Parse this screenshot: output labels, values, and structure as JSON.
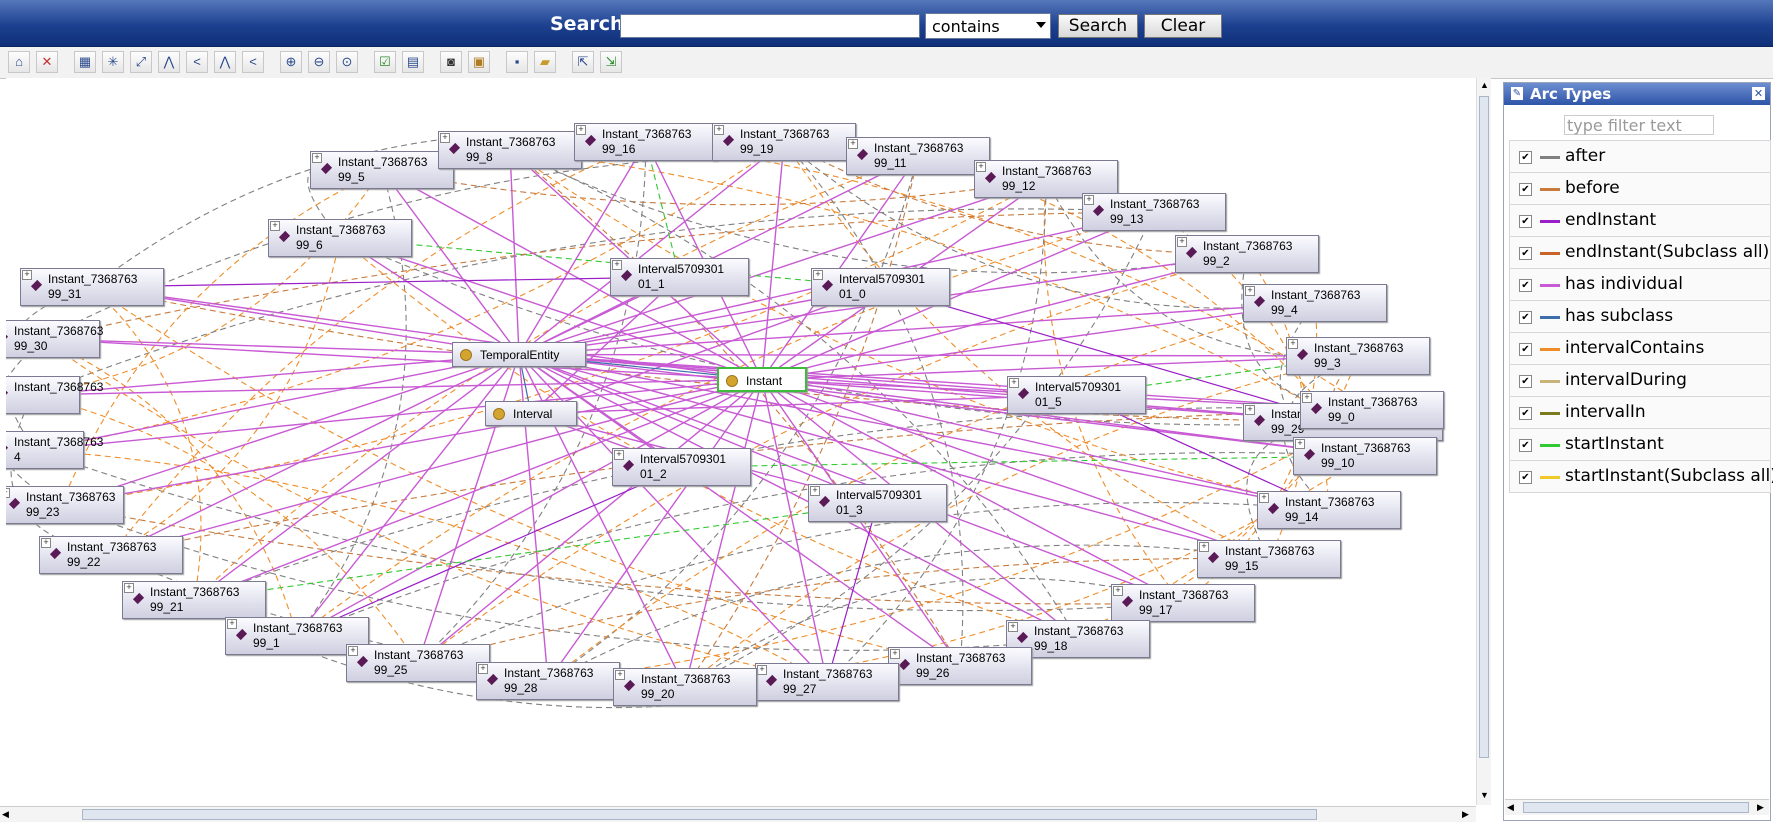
{
  "search": {
    "label": "Search:",
    "value": "",
    "mode": "contains",
    "search_button": "Search",
    "clear_button": "Clear"
  },
  "toolbar": {
    "icons": [
      "home-icon",
      "reset-icon",
      "grid-layout-icon",
      "radial-layout-icon",
      "spring-layout-icon",
      "tree-down-icon",
      "tree-left-icon",
      "tree-down-alt-icon",
      "tree-left-alt-icon",
      "zoom-in-icon",
      "zoom-out-icon",
      "zoom-fit-icon",
      "filter-icon",
      "options-icon",
      "snapshot-icon",
      "export-image-icon",
      "save-icon",
      "open-icon",
      "export-icon",
      "import-icon"
    ]
  },
  "graph": {
    "classes": [
      {
        "id": "temporal",
        "label": "TemporalEntity",
        "selected": false
      },
      {
        "id": "interval",
        "label": "Interval",
        "selected": false
      },
      {
        "id": "instant",
        "label": "Instant",
        "selected": true
      }
    ],
    "individuals": [
      {
        "id": "i5",
        "label": "Instant_7368763\n99_5"
      },
      {
        "id": "i8",
        "label": "Instant_7368763\n99_8"
      },
      {
        "id": "i16",
        "label": "Instant_7368763\n99_16"
      },
      {
        "id": "i19",
        "label": "Instant_7368763\n99_19"
      },
      {
        "id": "i11",
        "label": "Instant_7368763\n99_11"
      },
      {
        "id": "i12",
        "label": "Instant_7368763\n99_12"
      },
      {
        "id": "i13",
        "label": "Instant_7368763\n99_13"
      },
      {
        "id": "i6",
        "label": "Instant_7368763\n99_6"
      },
      {
        "id": "i2",
        "label": "Instant_7368763\n99_2"
      },
      {
        "id": "i31",
        "label": "Instant_7368763\n99_31"
      },
      {
        "id": "i4",
        "label": "Instant_7368763\n99_4"
      },
      {
        "id": "i30",
        "label": "Instant_7368763\n99_30"
      },
      {
        "id": "i3",
        "label": "Instant_7368763\n99_3"
      },
      {
        "id": "ix",
        "label": "Instant_7368763\n"
      },
      {
        "id": "i29",
        "label": "Instant_7368763\n99_29"
      },
      {
        "id": "i0",
        "label": "Instant_7368763\n99_0"
      },
      {
        "id": "i24",
        "label": "Instant_7368763\n4"
      },
      {
        "id": "i10",
        "label": "Instant_7368763\n99_10"
      },
      {
        "id": "i23",
        "label": "Instant_7368763\n99_23"
      },
      {
        "id": "i14",
        "label": "Instant_7368763\n99_14"
      },
      {
        "id": "i22",
        "label": "Instant_7368763\n99_22"
      },
      {
        "id": "i15",
        "label": "Instant_7368763\n99_15"
      },
      {
        "id": "i21",
        "label": "Instant_7368763\n99_21"
      },
      {
        "id": "i17",
        "label": "Instant_7368763\n99_17"
      },
      {
        "id": "i1",
        "label": "Instant_7368763\n99_1"
      },
      {
        "id": "i18",
        "label": "Instant_7368763\n99_18"
      },
      {
        "id": "i25",
        "label": "Instant_7368763\n99_25"
      },
      {
        "id": "i26",
        "label": "Instant_7368763\n99_26"
      },
      {
        "id": "i28",
        "label": "Instant_7368763\n99_28"
      },
      {
        "id": "i27",
        "label": "Instant_7368763\n99_27"
      },
      {
        "id": "i20",
        "label": "Instant_7368763\n99_20"
      },
      {
        "id": "int1",
        "label": "Interval5709301\n01_1"
      },
      {
        "id": "int0",
        "label": "Interval5709301\n01_0"
      },
      {
        "id": "int5",
        "label": "Interval5709301\n01_5"
      },
      {
        "id": "int2",
        "label": "Interval5709301\n01_2"
      },
      {
        "id": "int3",
        "label": "Interval5709301\n01_3"
      }
    ]
  },
  "panel": {
    "title": "Arc Types",
    "filter_placeholder": "type filter text",
    "arc_types": [
      {
        "name": "after",
        "color": "#808080",
        "checked": true
      },
      {
        "name": "before",
        "color": "#c87a3c",
        "checked": true
      },
      {
        "name": "endInstant",
        "color": "#9a1ec8",
        "checked": true
      },
      {
        "name": "endInstant(Subclass all)",
        "color": "#c8642a",
        "checked": true
      },
      {
        "name": "has individual",
        "color": "#c85ad4",
        "checked": true
      },
      {
        "name": "has subclass",
        "color": "#3c6eaa",
        "checked": true
      },
      {
        "name": "intervalContains",
        "color": "#f08c28",
        "checked": true
      },
      {
        "name": "intervalDuring",
        "color": "#c8b478",
        "checked": true
      },
      {
        "name": "intervalIn",
        "color": "#7a7a1e",
        "checked": true
      },
      {
        "name": "startInstant",
        "color": "#32c832",
        "checked": true
      },
      {
        "name": "startInstant(Subclass all)",
        "color": "#f0c828",
        "checked": true
      }
    ]
  }
}
